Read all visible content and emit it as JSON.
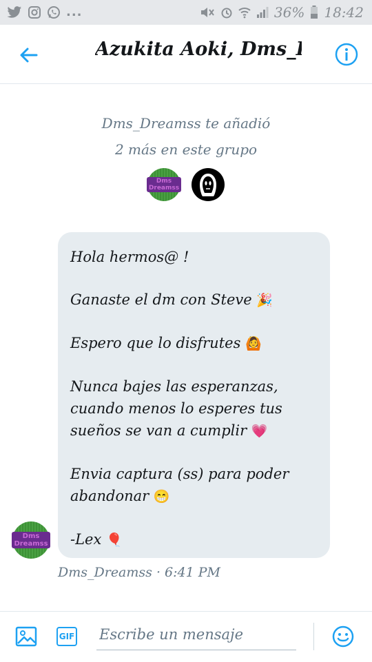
{
  "status_bar": {
    "left_icons": [
      "twitter-icon",
      "instagram-icon",
      "whatsapp-icon"
    ],
    "more": "...",
    "battery": "36%",
    "time": "18:42"
  },
  "header": {
    "title": "Azukita Aoki, Dms_D..."
  },
  "system_message": {
    "line1": "Dms_Dreamss te añadió",
    "line2": "2 más en este grupo",
    "avatar_logo_text": "Dms Dreamss"
  },
  "message": {
    "lines": [
      "Hola hermos@ !",
      "Ganaste el dm con Steve",
      "Espero que lo disfrutes",
      "Nunca bajes las esperanzas,",
      "cuando menos lo esperes tus",
      "sueños se van a cumplir",
      "Envia captura (ss) para poder",
      "abandonar",
      "-Lex"
    ],
    "emojis": {
      "party": "🎉",
      "raised_hands": "🙆",
      "heart": "💗",
      "smile": "😁",
      "balloon": "🎈"
    },
    "sender": "Dms_Dreamss",
    "separator": "·",
    "time": "6:41 PM"
  },
  "compose": {
    "gif_label": "GIF",
    "placeholder": "Escribe un mensaje"
  },
  "colors": {
    "accent": "#1da1f2",
    "bubble": "#e6ecf0",
    "muted": "#657786"
  }
}
